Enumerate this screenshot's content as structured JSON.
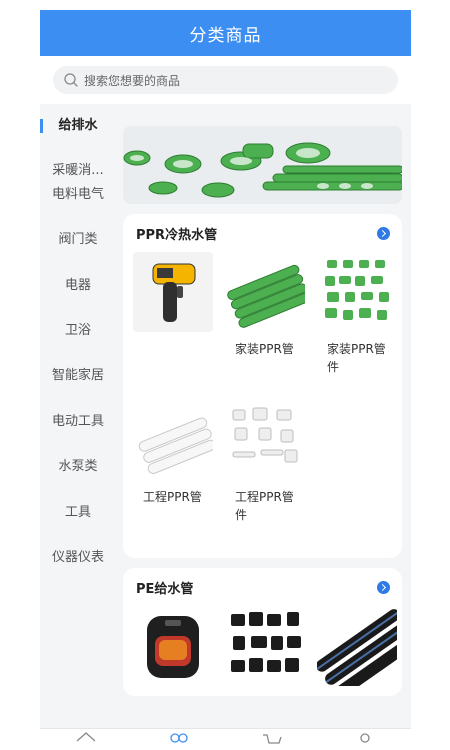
{
  "header": {
    "title": "分类商品"
  },
  "search": {
    "placeholder": "搜索您想要的商品"
  },
  "sidebar": {
    "items": [
      {
        "label": "给排水",
        "active": true
      },
      {
        "label": "采暖消..."
      },
      {
        "label": "电料电气"
      },
      {
        "label": "阀门类"
      },
      {
        "label": "电器"
      },
      {
        "label": "卫浴"
      },
      {
        "label": "智能家居"
      },
      {
        "label": "电动工具"
      },
      {
        "label": "水泵类"
      },
      {
        "label": "工具"
      },
      {
        "label": "仪器仪表"
      }
    ]
  },
  "sections": [
    {
      "title": "PPR冷热水管",
      "products": [
        {
          "name": ""
        },
        {
          "name": "家装PPR管"
        },
        {
          "name": "家装PPR管件"
        },
        {
          "name": "工程PPR管"
        },
        {
          "name": "工程PPR管件"
        }
      ]
    },
    {
      "title": "PE给水管",
      "products": [
        {
          "name": ""
        },
        {
          "name": ""
        },
        {
          "name": ""
        }
      ]
    }
  ],
  "colors": {
    "accent": "#3d8ef2",
    "pipe_green": "#4caf50",
    "more_blue": "#2f7ae5"
  },
  "icons": {
    "search": "search-icon",
    "more": "chevron-right-circle-icon"
  }
}
